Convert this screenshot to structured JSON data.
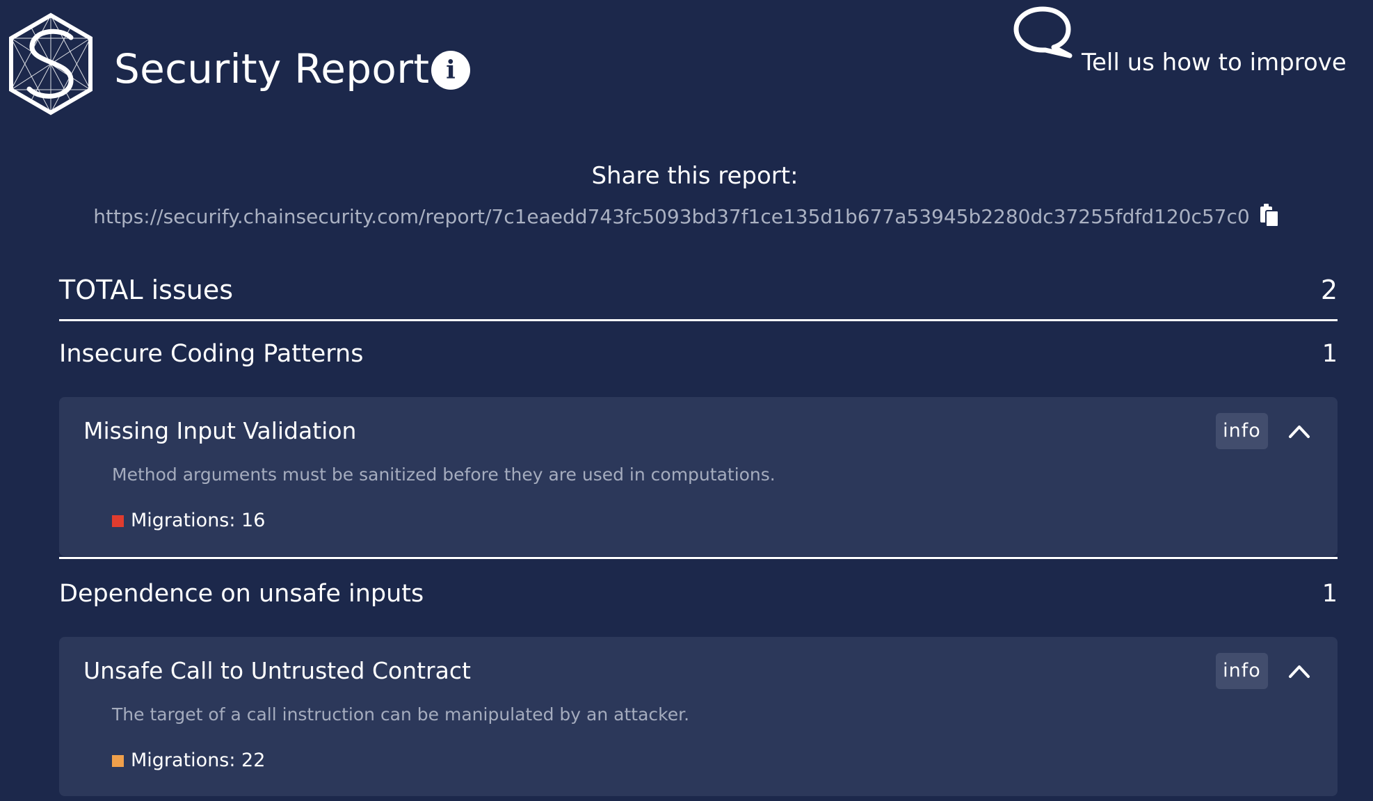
{
  "header": {
    "title": "Security Report",
    "info_icon": "info-circle-icon",
    "logo_icon": "securify-hexagon-logo",
    "feedback_label": "Tell us how to improve",
    "feedback_icon": "speech-bubble-icon"
  },
  "share": {
    "title": "Share this report:",
    "url": "https://securify.chainsecurity.com/report/7c1eaedd743fc5093bd37f1ce135d1b677a53945b2280dc37255fdfd120c57c0",
    "copy_icon": "clipboard-icon"
  },
  "totals": {
    "label": "TOTAL issues",
    "count": "2"
  },
  "categories": [
    {
      "name": "Insecure Coding Patterns",
      "count": "1",
      "issues": [
        {
          "title": "Missing Input Validation",
          "badge": "info",
          "description": "Method arguments must be sanitized before they are used in computations.",
          "location": "Migrations: 16",
          "severity_color": "#e03c2e"
        }
      ]
    },
    {
      "name": "Dependence on unsafe inputs",
      "count": "1",
      "issues": [
        {
          "title": "Unsafe Call to Untrusted Contract",
          "badge": "info",
          "description": "The target of a call instruction can be manipulated by an attacker.",
          "location": "Migrations: 22",
          "severity_color": "#f0a04b"
        }
      ]
    }
  ],
  "colors": {
    "background": "#1c284b",
    "card": "#2c385a",
    "badge": "#424d6d",
    "muted_text": "#a5acbe"
  }
}
